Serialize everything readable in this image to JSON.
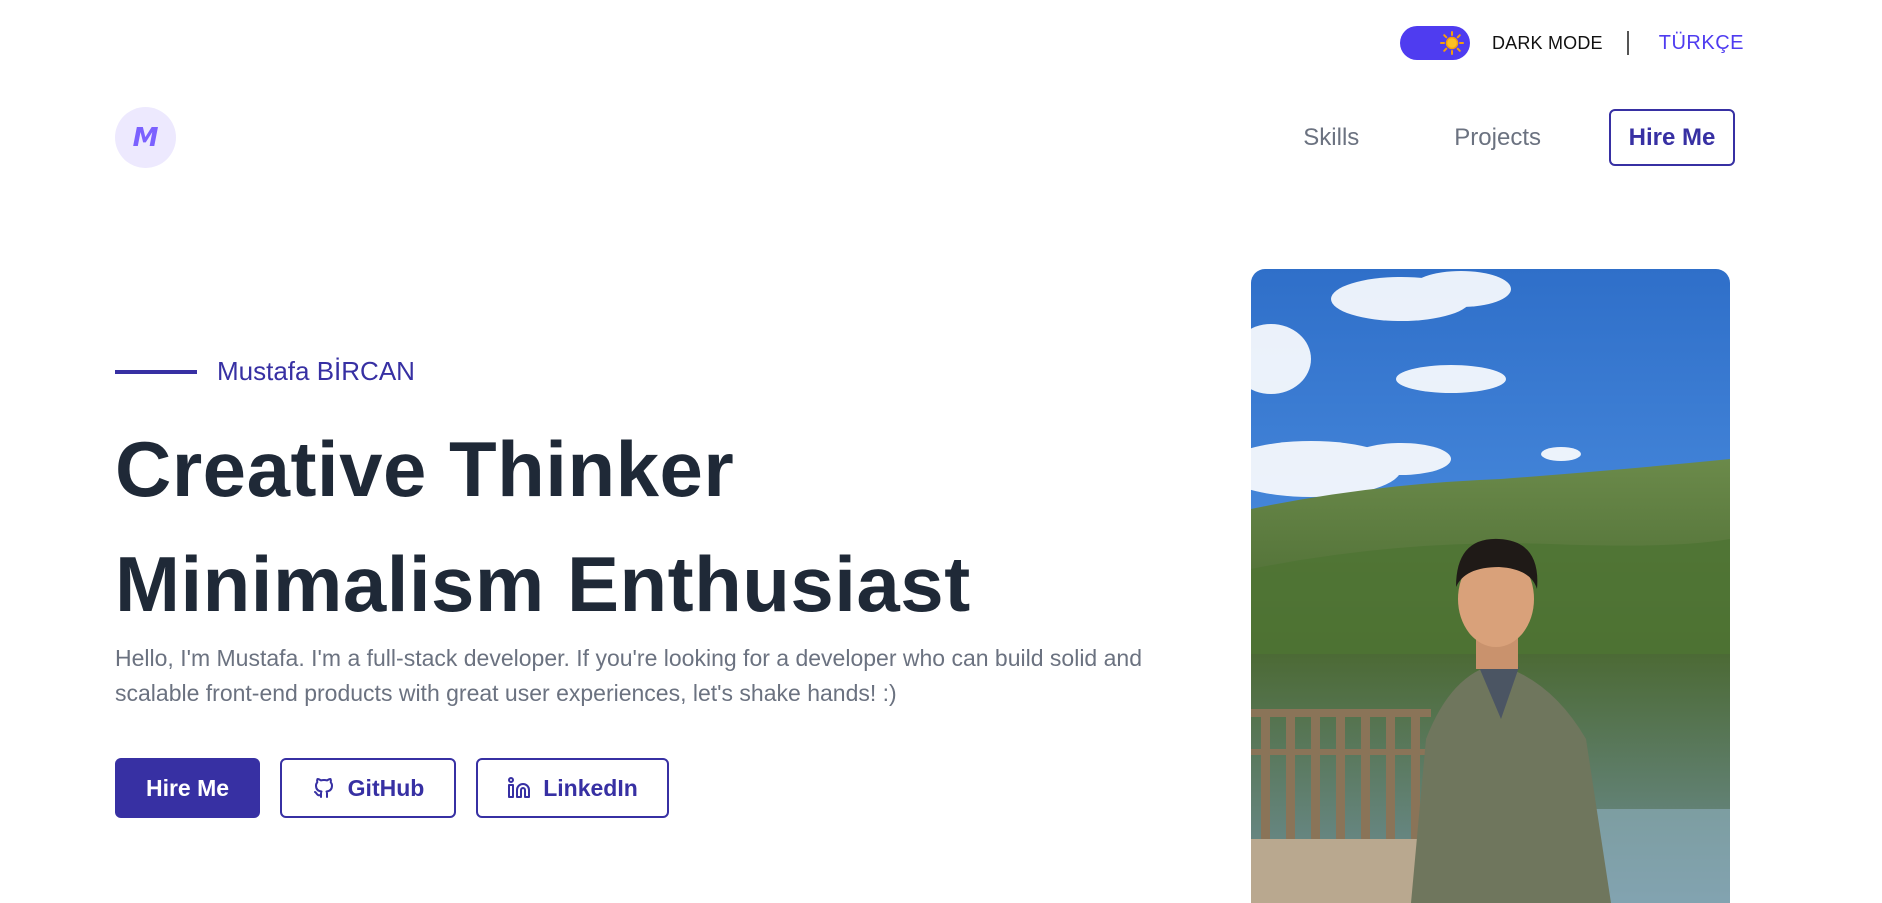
{
  "utility": {
    "dark_mode_label": "DARK MODE",
    "language_label": "TÜRKÇE"
  },
  "nav": {
    "logo_letter": "M",
    "skills": "Skills",
    "projects": "Projects",
    "hire_me": "Hire Me"
  },
  "hero": {
    "name": "Mustafa BİRCAN",
    "headline_line1": "Creative Thinker",
    "headline_line2": "Minimalism Enthusiast",
    "intro_line1": "Hello, I'm Mustafa. I'm a full-stack developer. If you're looking for a developer who can build solid and",
    "intro_line2": "scalable front-end products with great user experiences, let's shake hands! :)",
    "cta_hire": "Hire Me",
    "cta_github": "GitHub",
    "cta_linkedin": "LinkedIn"
  },
  "colors": {
    "accent": "#3730a3",
    "toggle": "#4f3cf0",
    "sun": "#f59e0b"
  },
  "icons": [
    "sun-icon",
    "github-icon",
    "linkedin-icon"
  ]
}
